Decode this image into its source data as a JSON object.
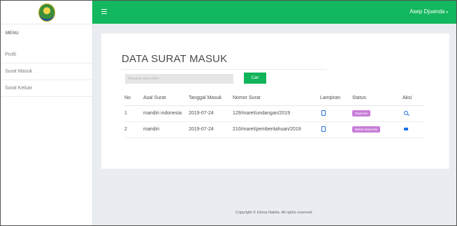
{
  "sidebar": {
    "menu_heading": "MENU",
    "items": [
      {
        "label": "Profil"
      },
      {
        "label": "Surat Masuk"
      },
      {
        "label": "Surat Keluar"
      }
    ]
  },
  "topbar": {
    "user_name": "Asep Djuanda",
    "user_caret": "▾",
    "color": "#13b75d"
  },
  "main": {
    "title": "DATA SURAT MASUK",
    "search": {
      "placeholder": "Masukan data disini",
      "value": ""
    },
    "search_button": "Cari",
    "columns": [
      "No",
      "Asal Surat",
      "Tanggal Masuk",
      "Nomor Surat",
      "Lampiran",
      "Status",
      "Aksi"
    ],
    "rows": [
      {
        "no": "1",
        "asal": "mandiri indonesia",
        "tanggal": "2019-07-24",
        "nomor": "129/maret/undangan/2019",
        "lampiran_icon": "file-icon",
        "status": "Disposisi",
        "aksi_icon": "search-icon"
      },
      {
        "no": "2",
        "asal": "mandiri",
        "tanggal": "2019-07-24",
        "nomor": "210/maret/pemberitahuan/2019",
        "lampiran_icon": "file-icon",
        "status": "Belum Disposisi",
        "aksi_icon": "mail-icon"
      }
    ]
  },
  "footer": {
    "text": "Copyright © Ishma Nabila. All rights reserved."
  },
  "colors": {
    "accent": "#13b75d",
    "badge": "#c77dd8",
    "link_icon": "#1d6ee8"
  }
}
